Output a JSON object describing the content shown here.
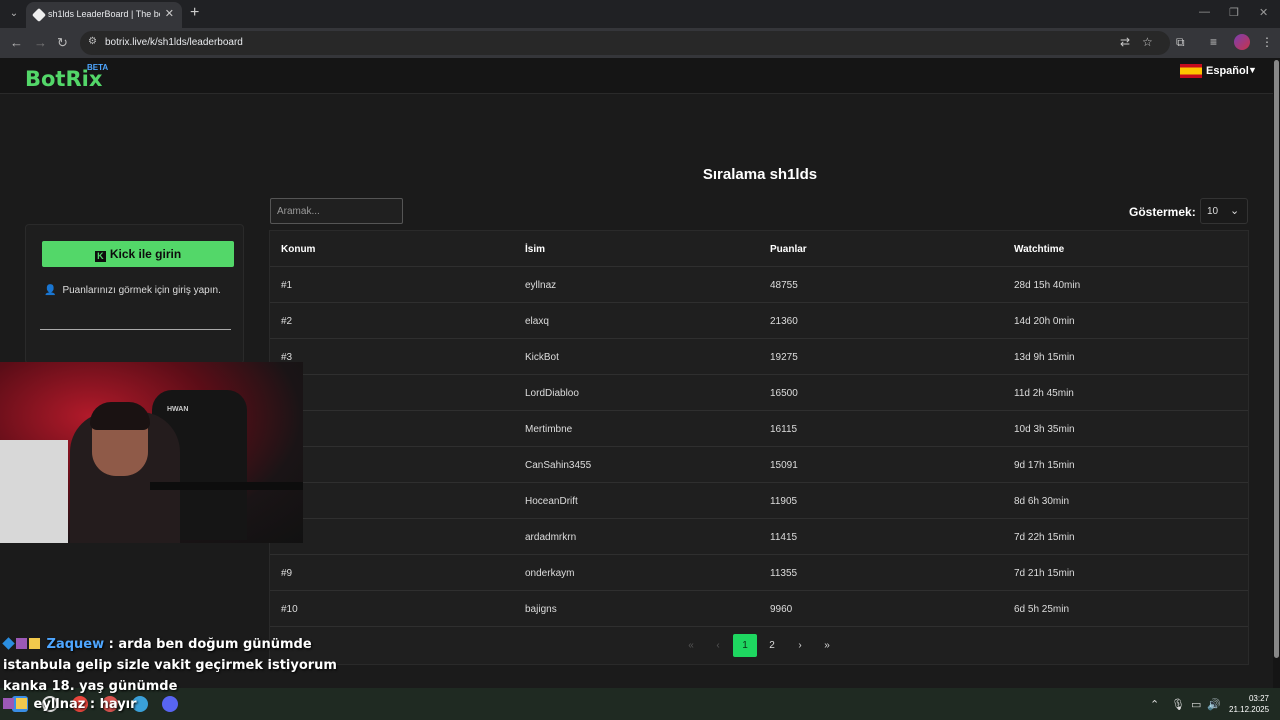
{
  "browser": {
    "tab_title": "sh1lds LeaderBoard | The best C",
    "url": "botrix.live/k/sh1lds/leaderboard"
  },
  "site": {
    "logo": "BotRix",
    "beta": "BETA",
    "language": "Español"
  },
  "page": {
    "title": "Sıralama sh1lds"
  },
  "login": {
    "button": "Kick ile girin",
    "hint": "Puanlarınızı görmek için giriş yapın."
  },
  "controls": {
    "search_placeholder": "Aramak...",
    "show_label": "Göstermek:",
    "show_value": "10"
  },
  "table": {
    "headers": [
      "Konum",
      "İsim",
      "Puanlar",
      "Watchtime"
    ],
    "rows": [
      {
        "rank": "#1",
        "name": "eyllnaz",
        "points": "48755",
        "watchtime": "28d 15h 40min"
      },
      {
        "rank": "#2",
        "name": "elaxq",
        "points": "21360",
        "watchtime": "14d 20h 0min"
      },
      {
        "rank": "#3",
        "name": "KickBot",
        "points": "19275",
        "watchtime": "13d 9h 15min"
      },
      {
        "rank": "",
        "name": "LordDiabloo",
        "points": "16500",
        "watchtime": "11d 2h 45min"
      },
      {
        "rank": "",
        "name": "Mertimbne",
        "points": "16115",
        "watchtime": "10d 3h 35min"
      },
      {
        "rank": "",
        "name": "CanSahin3455",
        "points": "15091",
        "watchtime": "9d 17h 15min"
      },
      {
        "rank": "",
        "name": "HoceanDrift",
        "points": "11905",
        "watchtime": "8d 6h 30min"
      },
      {
        "rank": "",
        "name": "ardadmrkrn",
        "points": "11415",
        "watchtime": "7d 22h 15min"
      },
      {
        "rank": "#9",
        "name": "onderkaym",
        "points": "11355",
        "watchtime": "7d 21h 15min"
      },
      {
        "rank": "#10",
        "name": "bajigns",
        "points": "9960",
        "watchtime": "6d 5h 25min"
      }
    ]
  },
  "pagination": {
    "first": "«",
    "prev": "‹",
    "pages": [
      "1",
      "2"
    ],
    "next": "›",
    "last": "»"
  },
  "chat": {
    "user1": "Zaquew",
    "msg1": ": arda ben doğum günümde istanbula gelip sizle vakit geçirmek istiyorum kanka 18. yaş günümde",
    "user2": "eyllnaz",
    "msg2": ": hayır"
  },
  "taskbar": {
    "time": "03:27",
    "date": "21.12.2025"
  }
}
